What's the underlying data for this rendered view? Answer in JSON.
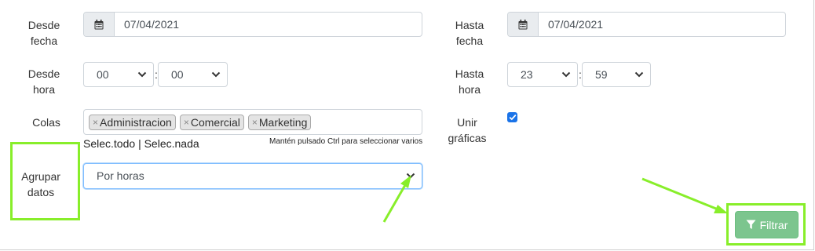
{
  "left": {
    "desde_fecha": {
      "label_line1": "Desde",
      "label_line2": "fecha",
      "value": "07/04/2021",
      "icon": "calendar-icon"
    },
    "desde_hora": {
      "label_line1": "Desde",
      "label_line2": "hora",
      "hour": "00",
      "minute": "00",
      "separator": ":"
    },
    "colas": {
      "label": "Colas",
      "tags": [
        {
          "remove": "×",
          "text": "Administracion"
        },
        {
          "remove": "×",
          "text": "Comercial"
        },
        {
          "remove": "×",
          "text": "Marketing"
        }
      ],
      "select_all": "Selec.todo",
      "divider": "|",
      "select_none": "Selec.nada",
      "hint": "Mantén pulsado Ctrl para seleccionar varios"
    },
    "agrupar": {
      "label_line1": "Agrupar",
      "label_line2": "datos",
      "value": "Por horas"
    }
  },
  "right": {
    "hasta_fecha": {
      "label_line1": "Hasta",
      "label_line2": "fecha",
      "value": "07/04/2021",
      "icon": "calendar-icon"
    },
    "hasta_hora": {
      "label_line1": "Hasta",
      "label_line2": "hora",
      "hour": "23",
      "minute": "59",
      "separator": ":"
    },
    "unir": {
      "label_line1": "Unir",
      "label_line2": "gráficas",
      "checked": true
    }
  },
  "filter_button": {
    "label": "Filtrar",
    "icon": "filter-icon",
    "color": "#7cc58e"
  },
  "annotation_color": "#88ee2a"
}
